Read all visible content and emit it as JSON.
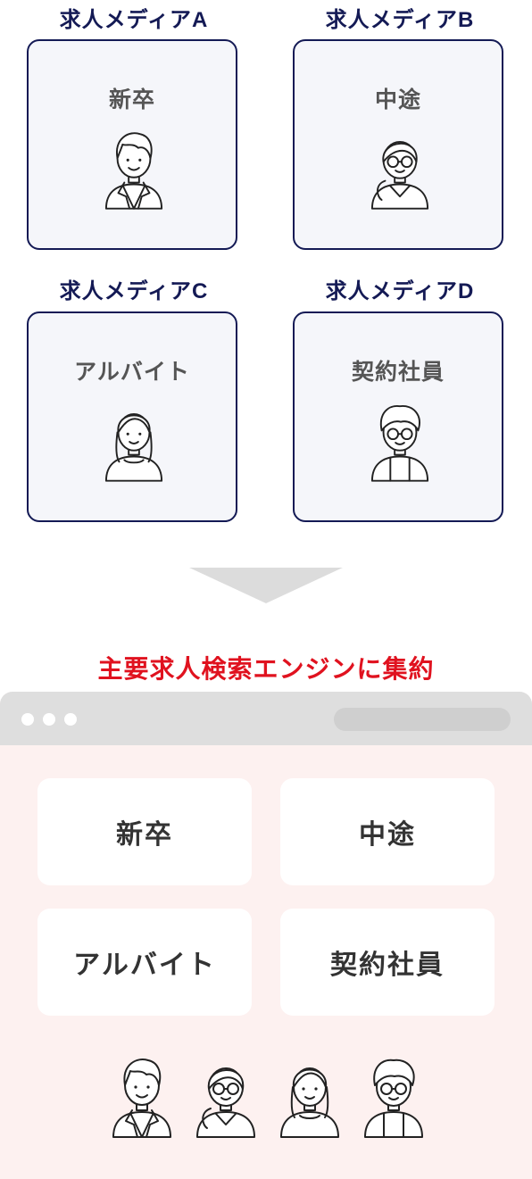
{
  "media": [
    {
      "title": "求人メディアA",
      "label": "新卒",
      "avatar": "man-icon"
    },
    {
      "title": "求人メディアB",
      "label": "中途",
      "avatar": "woman-glasses-icon"
    },
    {
      "title": "求人メディアC",
      "label": "アルバイト",
      "avatar": "woman-icon"
    },
    {
      "title": "求人メディアD",
      "label": "契約社員",
      "avatar": "man-glasses-icon"
    }
  ],
  "headline": "主要求人検索エンジンに集約",
  "browser": {
    "cards": [
      {
        "label": "新卒"
      },
      {
        "label": "中途"
      },
      {
        "label": "アルバイト"
      },
      {
        "label": "契約社員"
      }
    ]
  },
  "colors": {
    "navy": "#141a55",
    "accent_red": "#e0121f",
    "box_bg": "#f5f6fa",
    "browser_bg": "#fdf1f0",
    "browser_bar": "#dedede"
  }
}
